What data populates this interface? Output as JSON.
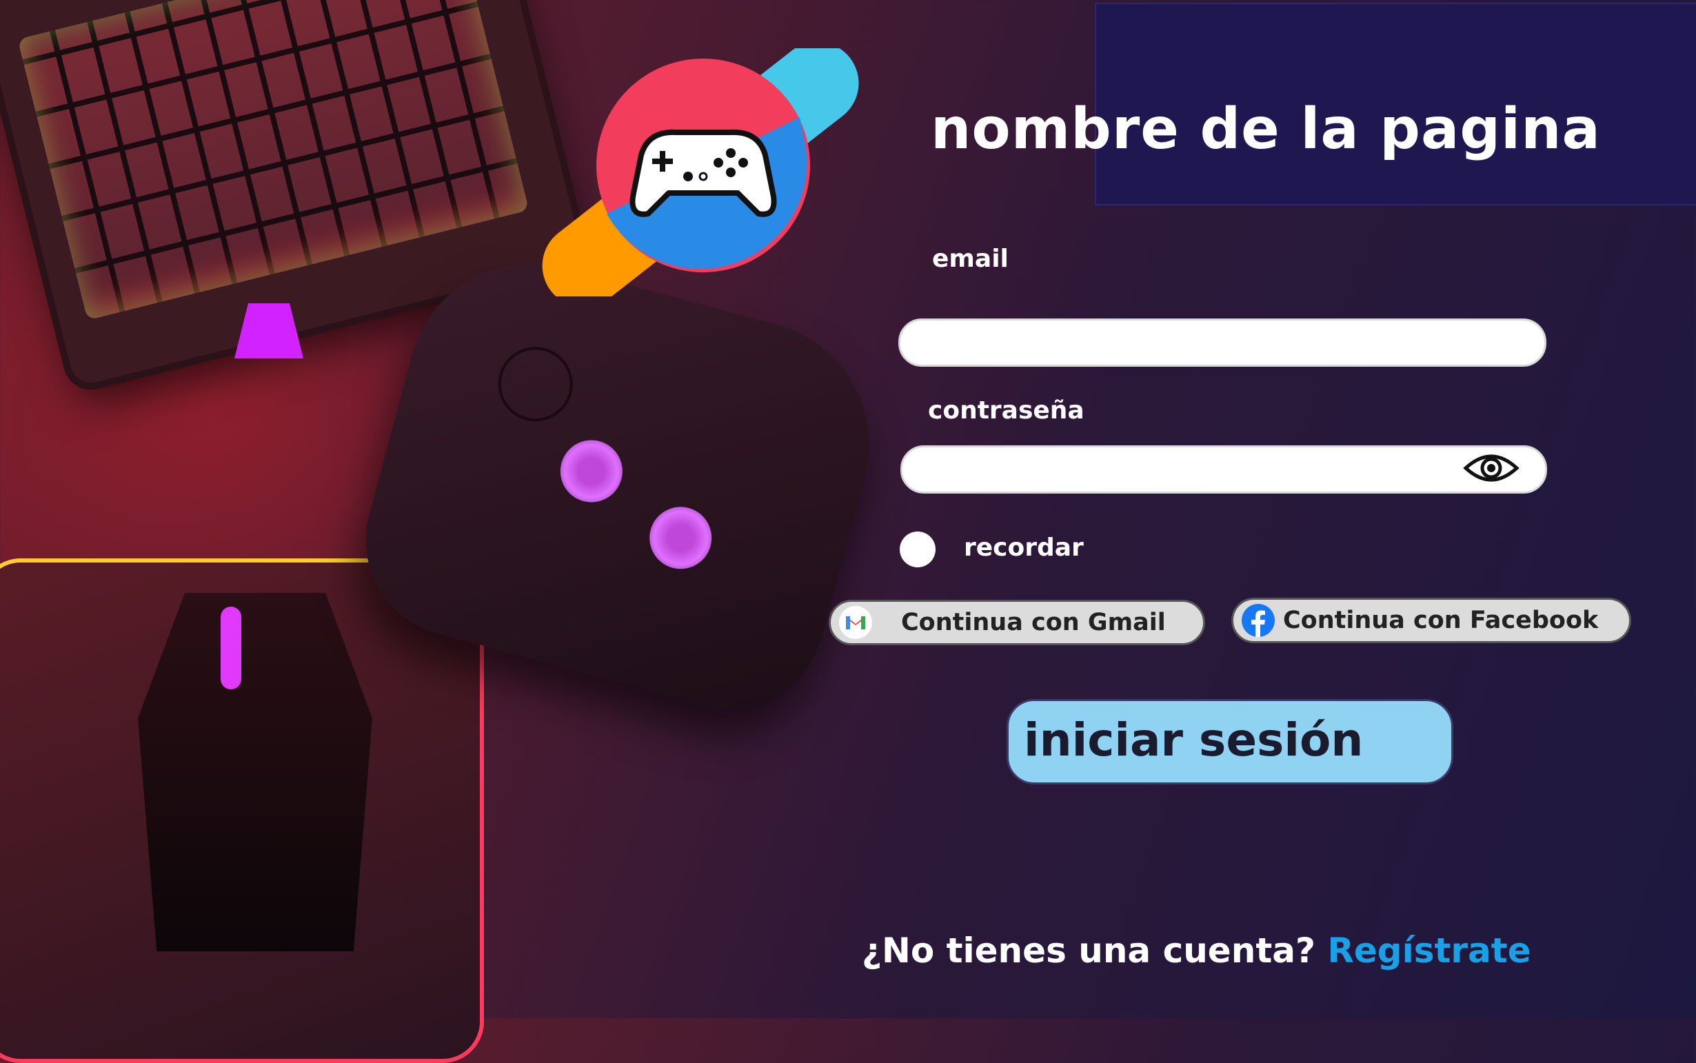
{
  "header": {
    "title": "nombre de la pagina"
  },
  "form": {
    "email_label": "email",
    "email_value": "",
    "password_label": "contraseña",
    "password_value": "",
    "remember_label": "recordar",
    "remember_checked": false
  },
  "social": {
    "gmail_label": "Continua con Gmail",
    "facebook_label": "Continua con Facebook"
  },
  "login": {
    "label": "iniciar sesión"
  },
  "signup": {
    "question": "¿No tienes una cuenta?",
    "link": "Regístrate"
  },
  "colors": {
    "accent_blue": "#1aa0e6",
    "login_button": "#8fd2f2",
    "header_box": "#1f1850",
    "logo_red": "#f23d5c",
    "logo_orange": "#ff9a00",
    "logo_blue": "#2a8be6",
    "logo_cyan": "#45c8ea"
  },
  "icons": [
    "gamepad-logo-icon",
    "eye-icon",
    "gmail-icon",
    "facebook-icon"
  ]
}
